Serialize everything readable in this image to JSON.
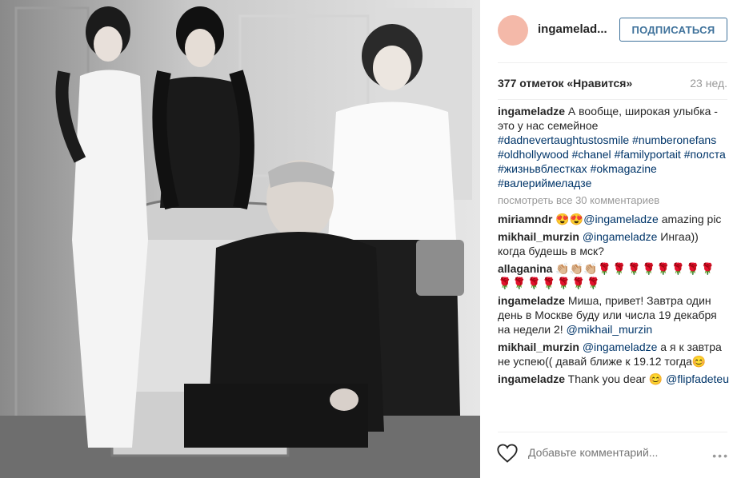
{
  "photo": {
    "alt_icon": "family-photo"
  },
  "header": {
    "username": "ingameladze",
    "username_display": "ingamelad...",
    "follow_label": "ПОДПИСАТЬСЯ"
  },
  "stats": {
    "likes": "377 отметок «Нравится»",
    "age": "23 нед."
  },
  "caption": {
    "user": "ingameladze",
    "text": "А вообще, широкая улыбка - это у нас семейное",
    "tags": [
      "#dadnevertaughtustosmile",
      "#numberonefans",
      "#oldhollywood",
      "#chanel",
      "#familyportait",
      "#полста",
      "#жизньвблестках",
      "#okmagazine",
      "#валериймеладзе"
    ]
  },
  "view_all": "посмотреть все 30 комментариев",
  "comments": [
    {
      "user": "miriamndr",
      "emoji": "😍😍",
      "mention": "@ingameladze",
      "text": " amazing pic"
    },
    {
      "user": "mikhail_murzin",
      "mention": "@ingameladze",
      "text": " Ингаа)) когда будешь в мск?"
    },
    {
      "user": "allaganina",
      "emoji_hands": "👏🏼👏🏼👏🏼",
      "emoji_roses": "🌹🌹🌹🌹🌹🌹🌹🌹🌹🌹🌹🌹🌹🌹🌹"
    },
    {
      "user": "ingameladze",
      "text": " Миша, привет! Завтра один день в Москве буду или числа 19 декабря на недели 2! ",
      "mention": "@mikhail_murzin"
    },
    {
      "user": "mikhail_murzin",
      "mention": "@ingameladze",
      "text": " а я к завтра не успею(( давай ближе к 19.12 тогда",
      "emoji": "😊"
    },
    {
      "user": "ingameladze",
      "text": " Thank you dear ",
      "emoji": "😊",
      "mention2": "@flipfadeteu"
    }
  ],
  "footer": {
    "add_comment_placeholder": "Добавьте комментарий...",
    "more": "•••"
  }
}
